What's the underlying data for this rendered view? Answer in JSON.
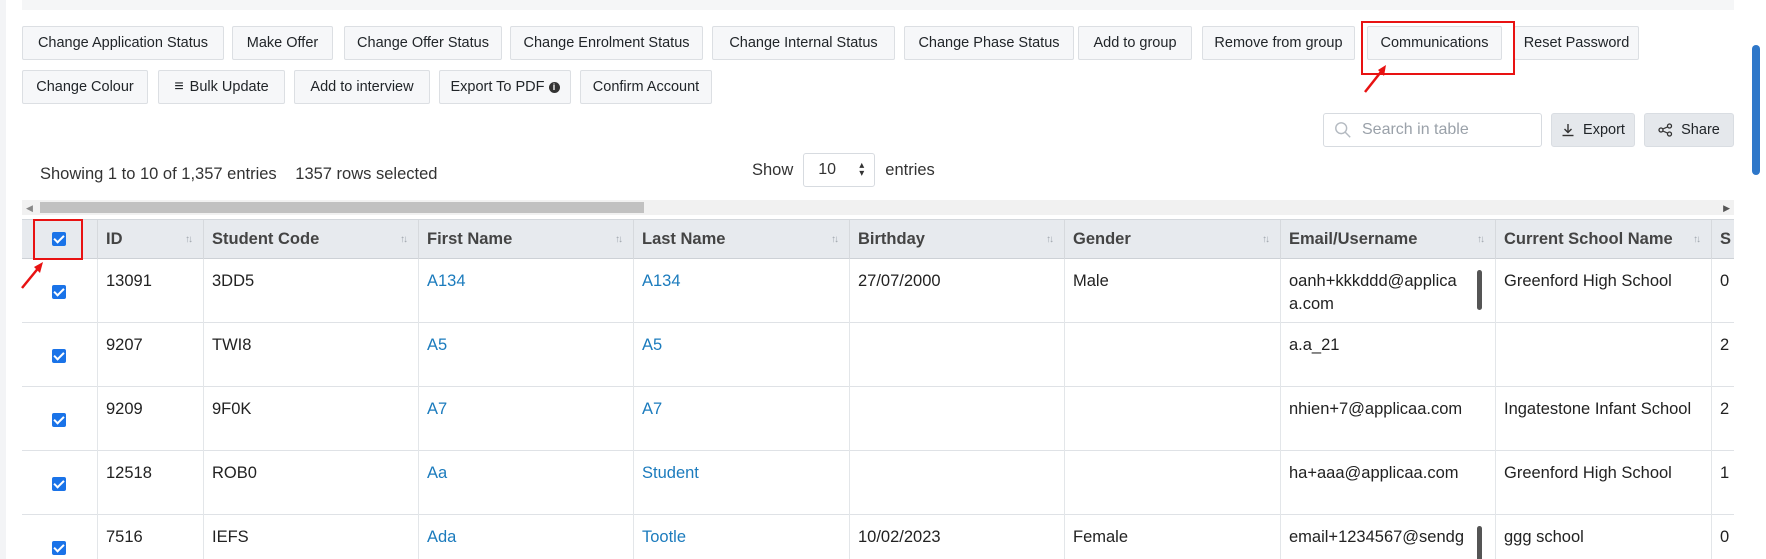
{
  "toolbar": {
    "row1": [
      "Change Application Status",
      "Make Offer",
      "Change Offer Status",
      "Change Enrolment Status",
      "Change Internal Status",
      "Change Phase Status",
      "Add to group",
      "Remove from group",
      "Communications",
      "Reset Password"
    ],
    "row2": [
      "Change Colour",
      "Bulk Update",
      "Add to interview",
      "Export To PDF",
      "Confirm Account"
    ]
  },
  "search": {
    "placeholder": "Search in table"
  },
  "actions": {
    "export_label": "Export",
    "share_label": "Share"
  },
  "table_info": {
    "showing": "Showing 1 to 10 of 1,357 entries",
    "selected": "1357 rows selected",
    "show_label": "Show",
    "page_size": "10",
    "entries_label": "entries"
  },
  "table": {
    "headers": [
      "ID",
      "Student Code",
      "First Name",
      "Last Name",
      "Birthday",
      "Gender",
      "Email/Username",
      "Current School Name",
      "S"
    ],
    "rows": [
      {
        "id": "13091",
        "code": "3DD5",
        "first": "A134",
        "last": "A134",
        "birthday": "27/07/2000",
        "gender": "Male",
        "email": "oanh+kkkddd@applicaa.com",
        "school": "Greenford High School",
        "extra": "0"
      },
      {
        "id": "9207",
        "code": "TWI8",
        "first": "A5",
        "last": "A5",
        "birthday": "",
        "gender": "",
        "email": "a.a_21",
        "school": "",
        "extra": "2"
      },
      {
        "id": "9209",
        "code": "9F0K",
        "first": "A7",
        "last": "A7",
        "birthday": "",
        "gender": "",
        "email": "nhien+7@applicaa.com",
        "school": "Ingatestone Infant School",
        "extra": "2"
      },
      {
        "id": "12518",
        "code": "ROB0",
        "first": "Aa",
        "last": "Student",
        "birthday": "",
        "gender": "",
        "email": "ha+aaa@applicaa.com",
        "school": "Greenford High School",
        "extra": "1"
      },
      {
        "id": "7516",
        "code": "IEFS",
        "first": "Ada",
        "last": "Tootle",
        "birthday": "10/02/2023",
        "gender": "Female",
        "email": "email+1234567@sendg",
        "school": "ggg school",
        "extra": "0"
      }
    ]
  },
  "colors": {
    "highlight": "#e81212",
    "checkbox": "#1a73e8",
    "link": "#1b7bbd"
  }
}
